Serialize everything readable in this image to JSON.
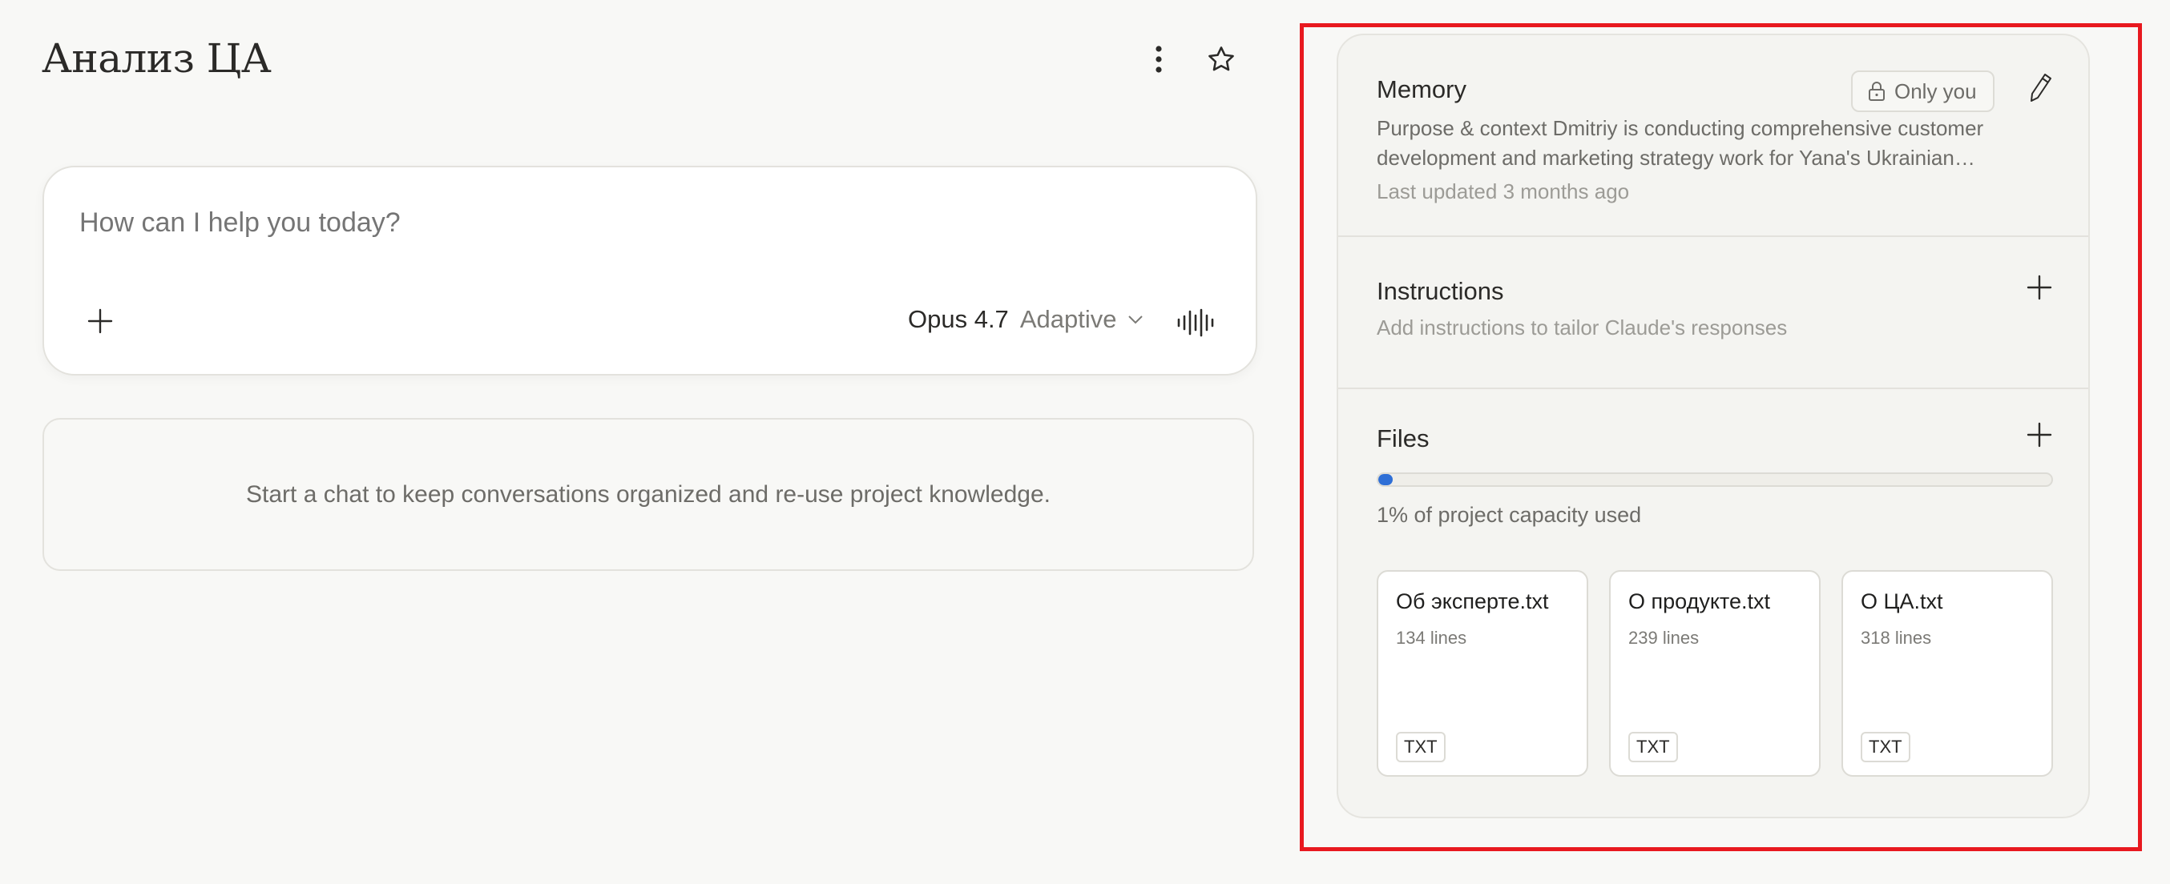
{
  "project": {
    "title": "Анализ ЦА"
  },
  "composer": {
    "placeholder": "How can I help you today?",
    "model_name": "Opus 4.7",
    "model_mode": "Adaptive"
  },
  "empty_state": {
    "text": "Start a chat to keep conversations organized and re-use project knowledge."
  },
  "memory": {
    "title": "Memory",
    "visibility": "Only you",
    "summary": "Purpose & context Dmitriy is conducting comprehensive customer development and marketing strategy work for Yana's Ukrainian…",
    "updated": "Last updated 3 months ago"
  },
  "instructions": {
    "title": "Instructions",
    "description": "Add instructions to tailor Claude's responses"
  },
  "files": {
    "title": "Files",
    "capacity_fraction": 0.01,
    "capacity_label": "1% of project capacity used",
    "items": [
      {
        "name": "Об эксперте.txt",
        "lines": "134 lines",
        "type": "TXT"
      },
      {
        "name": "О продукте.txt",
        "lines": "239 lines",
        "type": "TXT"
      },
      {
        "name": "О ЦА.txt",
        "lines": "318 lines",
        "type": "TXT"
      }
    ]
  },
  "colors": {
    "accent": "#2f6fd6",
    "highlight": "#e8191f",
    "background": "#f8f8f6"
  },
  "icons": {
    "more": "vertical-dots-icon",
    "favorite": "star-icon",
    "add": "plus-icon",
    "voice": "waveform-icon",
    "lock": "lock-icon",
    "edit": "pencil-icon",
    "dropdown": "chevron-down-icon"
  }
}
